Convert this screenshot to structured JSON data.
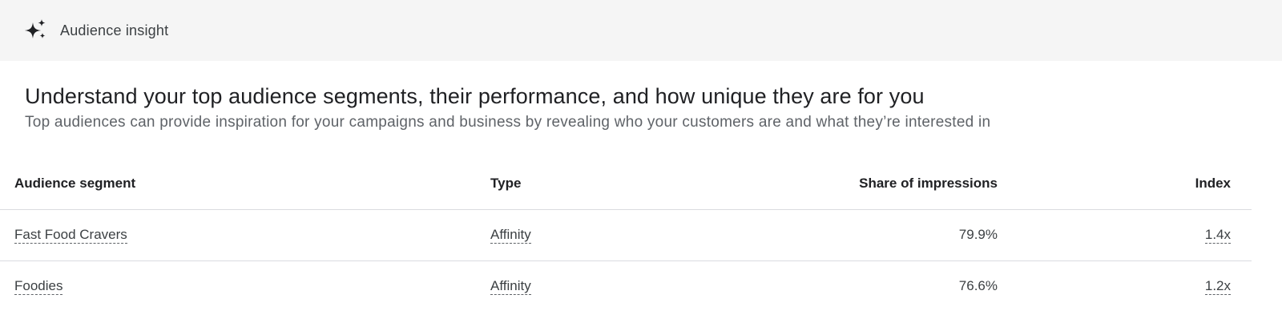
{
  "header": {
    "icon": "sparkle-icon",
    "title": "Audience insight"
  },
  "intro": {
    "headline": "Understand your top audience segments, their performance, and how unique they are for you",
    "subline": "Top audiences can provide inspiration for your campaigns and business by revealing who your customers are and what they’re interested in"
  },
  "table": {
    "columns": [
      "Audience segment",
      "Type",
      "Share of impressions",
      "Index"
    ],
    "rows": [
      {
        "segment": "Fast Food Cravers",
        "type": "Affinity",
        "share": "79.9%",
        "index": "1.4x"
      },
      {
        "segment": "Foodies",
        "type": "Affinity",
        "share": "76.6%",
        "index": "1.2x"
      }
    ]
  }
}
